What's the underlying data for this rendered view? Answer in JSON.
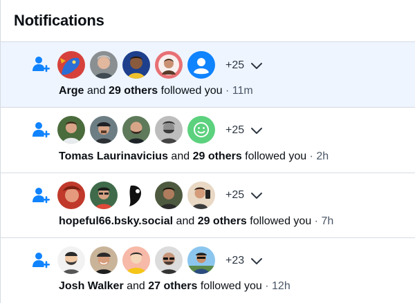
{
  "header": {
    "title": "Notifications"
  },
  "colors": {
    "accent": "#1083fe",
    "unread_bg": "#eef5ff",
    "divider": "#d4dbe2"
  },
  "notifications": [
    {
      "icon": "person-add-icon",
      "avatars": [
        "avatar-blue-dragon",
        "avatar-grey-man",
        "avatar-cartoon-man",
        "avatar-red-frame-man",
        "avatar-default-blue"
      ],
      "more": "+25",
      "actor": "Arge",
      "and": " and ",
      "others": "29 others",
      "action": " followed you",
      "sep": " · ",
      "time": "11m",
      "unread": true
    },
    {
      "icon": "person-add-icon",
      "avatars": [
        "avatar-smiling-man",
        "avatar-cap-man",
        "avatar-bald-beard",
        "avatar-bw-man",
        "avatar-green-smiley"
      ],
      "more": "+25",
      "actor": "Tomas Laurinavicius",
      "and": " and ",
      "others": "29 others",
      "action": " followed you",
      "sep": " · ",
      "time": "2h",
      "unread": false
    },
    {
      "icon": "person-add-icon",
      "avatars": [
        "avatar-red-woman",
        "avatar-glasses-man",
        "avatar-bw-figure",
        "avatar-dark-man",
        "avatar-selfie-man"
      ],
      "more": "+25",
      "actor": "hopeful66.bsky.social",
      "and": " and ",
      "others": "29 others",
      "action": " followed you",
      "sep": " · ",
      "time": "7h",
      "unread": false
    },
    {
      "icon": "person-add-icon",
      "avatars": [
        "avatar-cartoon-beard",
        "avatar-cap-smile",
        "avatar-yellow-hoodie",
        "avatar-sunglasses-bald",
        "avatar-outdoor-man"
      ],
      "more": "+23",
      "actor": "Josh Walker",
      "and": " and ",
      "others": "27 others",
      "action": " followed you",
      "sep": " · ",
      "time": "12h",
      "unread": false
    }
  ]
}
